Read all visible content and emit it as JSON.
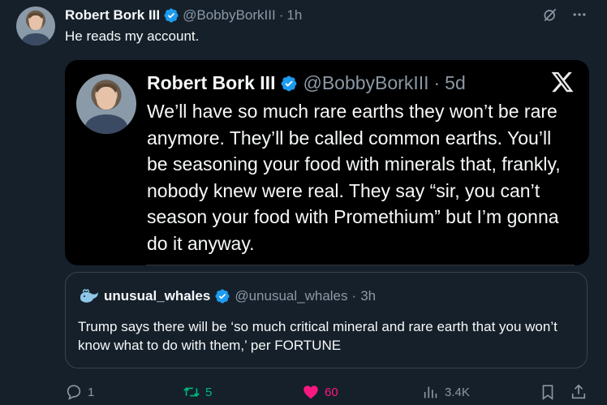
{
  "author": {
    "name": "Robert Bork III",
    "handle": "@BobbyBorkIII",
    "separator": "·",
    "time": "1h"
  },
  "tweet_text": "He reads my account.",
  "embedded_image": {
    "name": "Robert Bork III",
    "handle": "@BobbyBorkIII",
    "separator": "·",
    "time": "5d",
    "text": "We’ll have so much rare earths they won’t be rare anymore. They’ll be called common earths. You’ll be seasoning your food with minerals that, frankly, nobody knew were real. They say “sir, you can’t season your food with Promethium” but I’m gonna do it anyway."
  },
  "quoted": {
    "name": "unusual_whales",
    "handle": "@unusual_whales",
    "separator": "·",
    "time": "3h",
    "text": "Trump says there will be ‘so much critical mineral and rare earth that you won’t know what to do with them,’ per FORTUNE"
  },
  "actions": {
    "replies": "1",
    "reposts": "5",
    "likes": "60",
    "views": "3.4K"
  },
  "colors": {
    "background": "#15202b",
    "verified": "#1d9bf0",
    "repost_green": "#00ba7c",
    "like_pink": "#f91880",
    "muted": "#8b98a5"
  },
  "icons": [
    "verified-badge-icon",
    "grok-icon",
    "more-icon",
    "x-logo-icon",
    "whale-icon",
    "reply-icon",
    "repost-icon",
    "like-icon",
    "views-icon",
    "bookmark-icon",
    "share-icon"
  ]
}
